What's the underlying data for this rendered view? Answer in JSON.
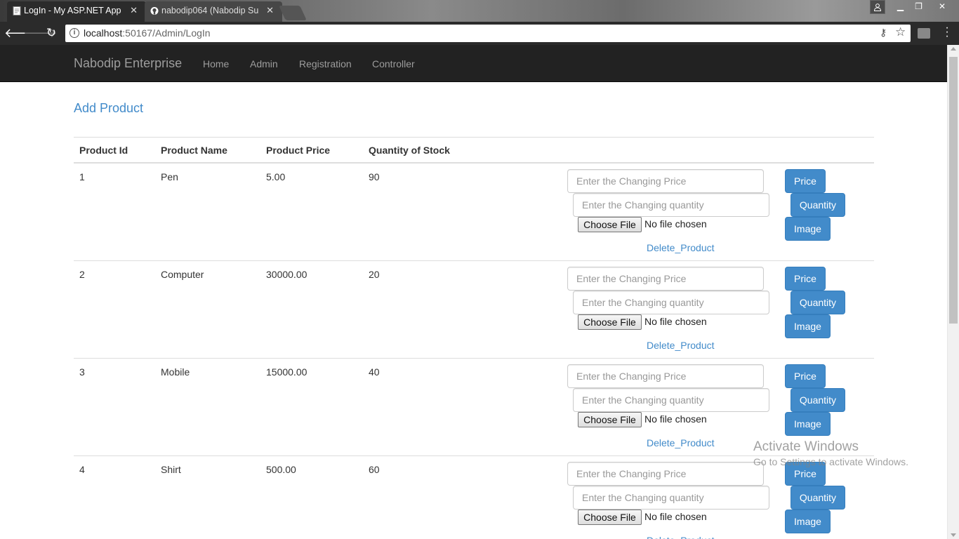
{
  "browser": {
    "tabs": [
      {
        "title": "LogIn - My ASP.NET App",
        "active": true
      },
      {
        "title": "nabodip064 (Nabodip Su",
        "active": false
      }
    ],
    "url_host": "localhost",
    "url_rest": ":50167/Admin/LogIn"
  },
  "navbar": {
    "brand": "Nabodip Enterprise",
    "links": [
      "Home",
      "Admin",
      "Registration",
      "Controller"
    ]
  },
  "page": {
    "title": "Add Product"
  },
  "table": {
    "headers": [
      "Product Id",
      "Product Name",
      "Product Price",
      "Quantity of Stock"
    ],
    "rows": [
      {
        "id": "1",
        "name": "Pen",
        "price": "5.00",
        "qty": "90"
      },
      {
        "id": "2",
        "name": "Computer",
        "price": "30000.00",
        "qty": "20"
      },
      {
        "id": "3",
        "name": "Mobile",
        "price": "15000.00",
        "qty": "40"
      },
      {
        "id": "4",
        "name": "Shirt",
        "price": "500.00",
        "qty": "60"
      }
    ]
  },
  "row_controls": {
    "price_placeholder": "Enter the Changing Price",
    "qty_placeholder": "Enter the Changing quantity",
    "choose_file_label": "Choose File",
    "no_file_text": "No file chosen",
    "price_button": "Price",
    "quantity_button": "Quantity",
    "image_button": "Image",
    "delete_link": "Delete_Product"
  },
  "watermark": {
    "line1": "Activate Windows",
    "line2": "Go to Settings to activate Windows."
  },
  "colors": {
    "primary": "#428bca",
    "navbar_bg": "#222222"
  }
}
